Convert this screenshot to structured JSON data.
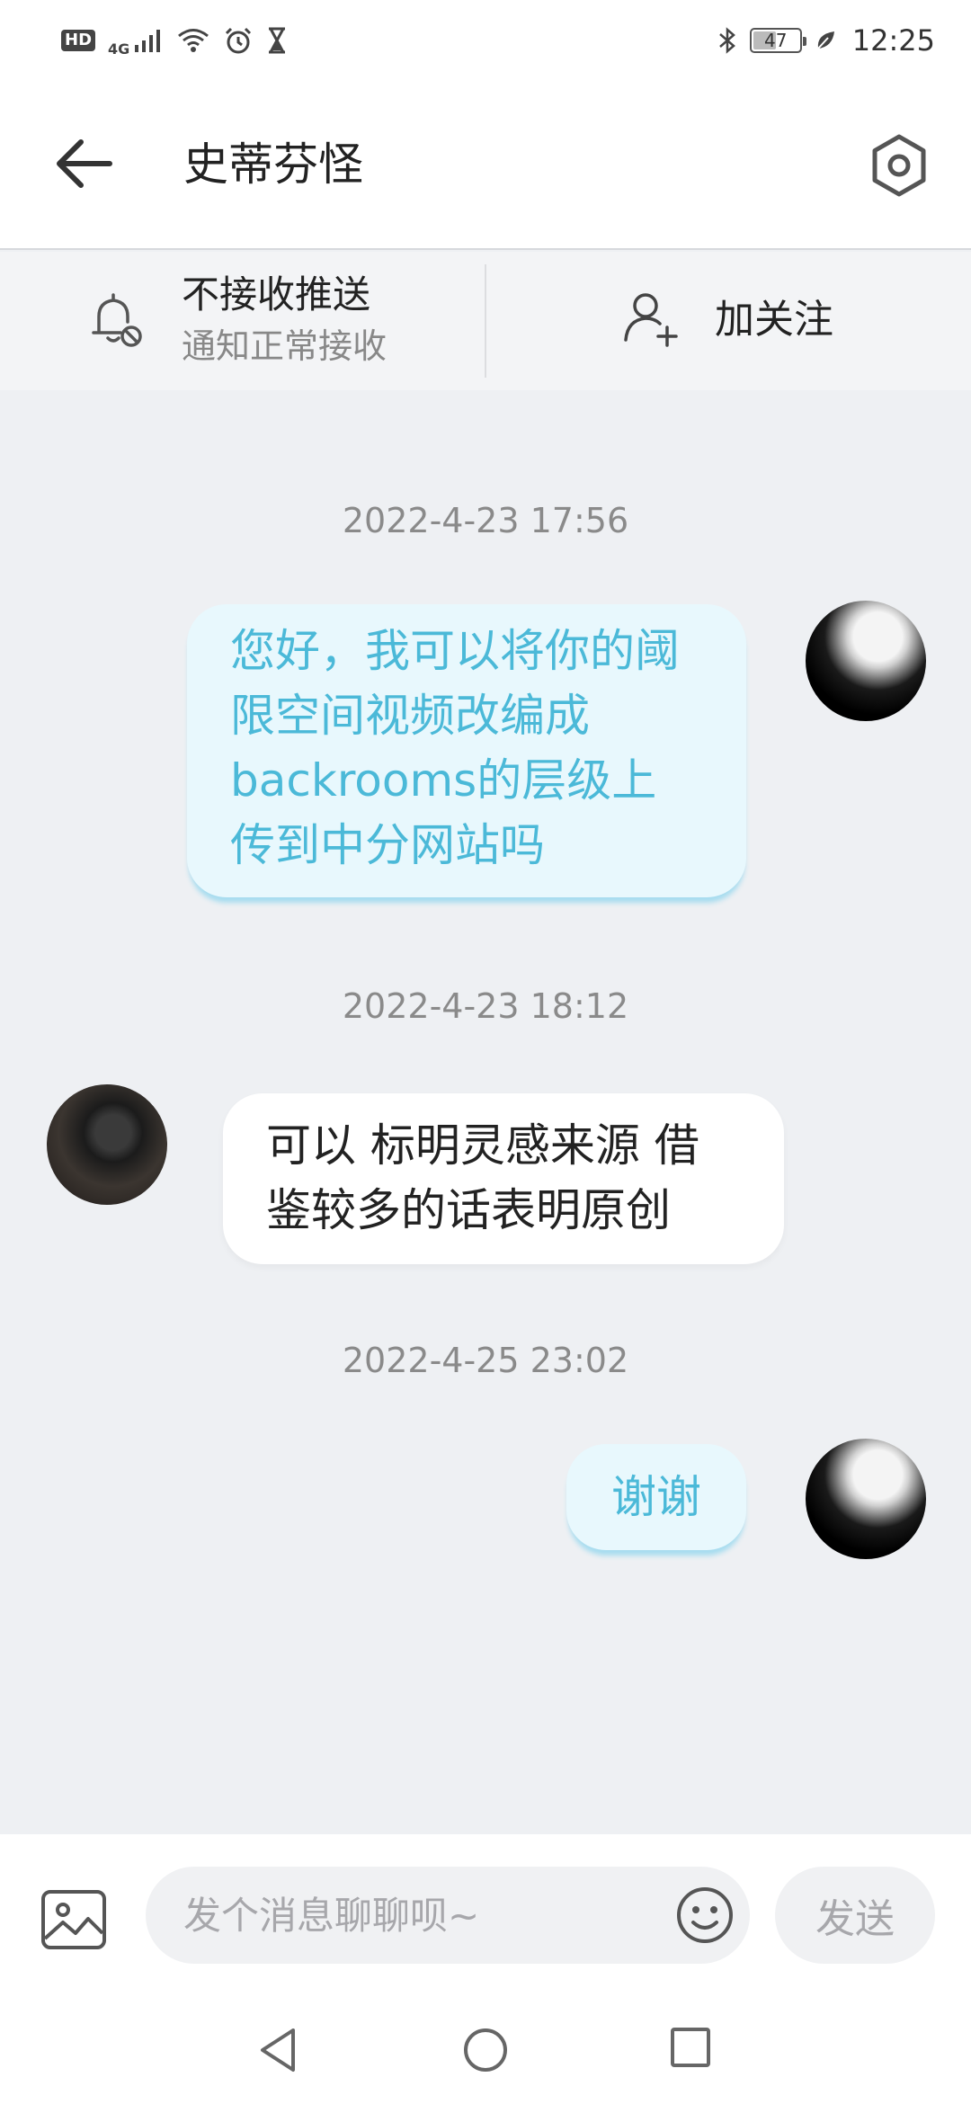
{
  "status_bar": {
    "hd": "HD",
    "network": "4G",
    "battery": "47",
    "time": "12:25",
    "icons": [
      "signal-icon",
      "wifi-icon",
      "alarm-icon",
      "hourglass-icon",
      "bluetooth-icon",
      "battery-icon",
      "leaf-icon"
    ]
  },
  "header": {
    "title": "史蒂芬怪"
  },
  "action_bar": {
    "push_title": "不接收推送",
    "push_subtitle": "通知正常接收",
    "follow_label": "加关注"
  },
  "messages": [
    {
      "timestamp": "2022-4-23 17:56",
      "side": "right",
      "text": "您好，我可以将你的阈限空间视频改编成backrooms的层级上传到中分网站吗"
    },
    {
      "timestamp": "2022-4-23 18:12",
      "side": "left",
      "text": "可以 标明灵感来源 借鉴较多的话表明原创"
    },
    {
      "timestamp": "2022-4-25 23:02",
      "side": "right",
      "text": "谢谢"
    }
  ],
  "input_bar": {
    "placeholder": "发个消息聊聊呗~",
    "send_label": "发送"
  },
  "colors": {
    "accent": "#4bb9d8",
    "outgoing_bubble": "#e8f8fd",
    "chat_bg": "#eef0f3"
  }
}
